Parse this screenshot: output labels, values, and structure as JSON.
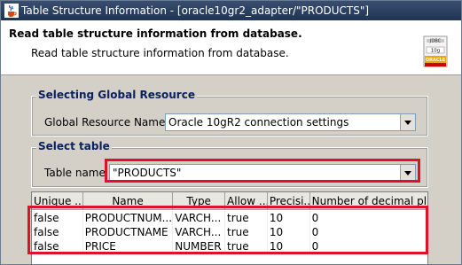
{
  "window": {
    "title": "Table Structure Information - [oracle10gr2_adapter/\"PRODUCTS\"]"
  },
  "header": {
    "title": "Read table structure information from database.",
    "description": "Read table structure information from database.",
    "logo_lines": [
      "JDBC",
      "10g",
      "ORACLE"
    ]
  },
  "global_resource": {
    "group_label": "Selecting Global Resource",
    "field_label": "Global Resource Name",
    "value": "Oracle 10gR2 connection settings"
  },
  "select_table": {
    "group_label": "Select table",
    "field_label": "Table name",
    "value": "\"PRODUCTS\""
  },
  "table": {
    "columns": [
      "Unique ...",
      "Name",
      "Type",
      "Allow ...",
      "Precisi...",
      "Number of decimal pl..."
    ],
    "rows": [
      [
        "false",
        "PRODUCTNUM...",
        "VARCH...",
        "true",
        "10",
        "0"
      ],
      [
        "false",
        "PRODUCTNAME",
        "VARCH...",
        "true",
        "10",
        "0"
      ],
      [
        "false",
        "PRICE",
        "NUMBER",
        "true",
        "10",
        "0"
      ]
    ]
  },
  "colors": {
    "highlight": "#e0102a",
    "group_label": "#0b2160",
    "titlebar": "#1f3453"
  }
}
